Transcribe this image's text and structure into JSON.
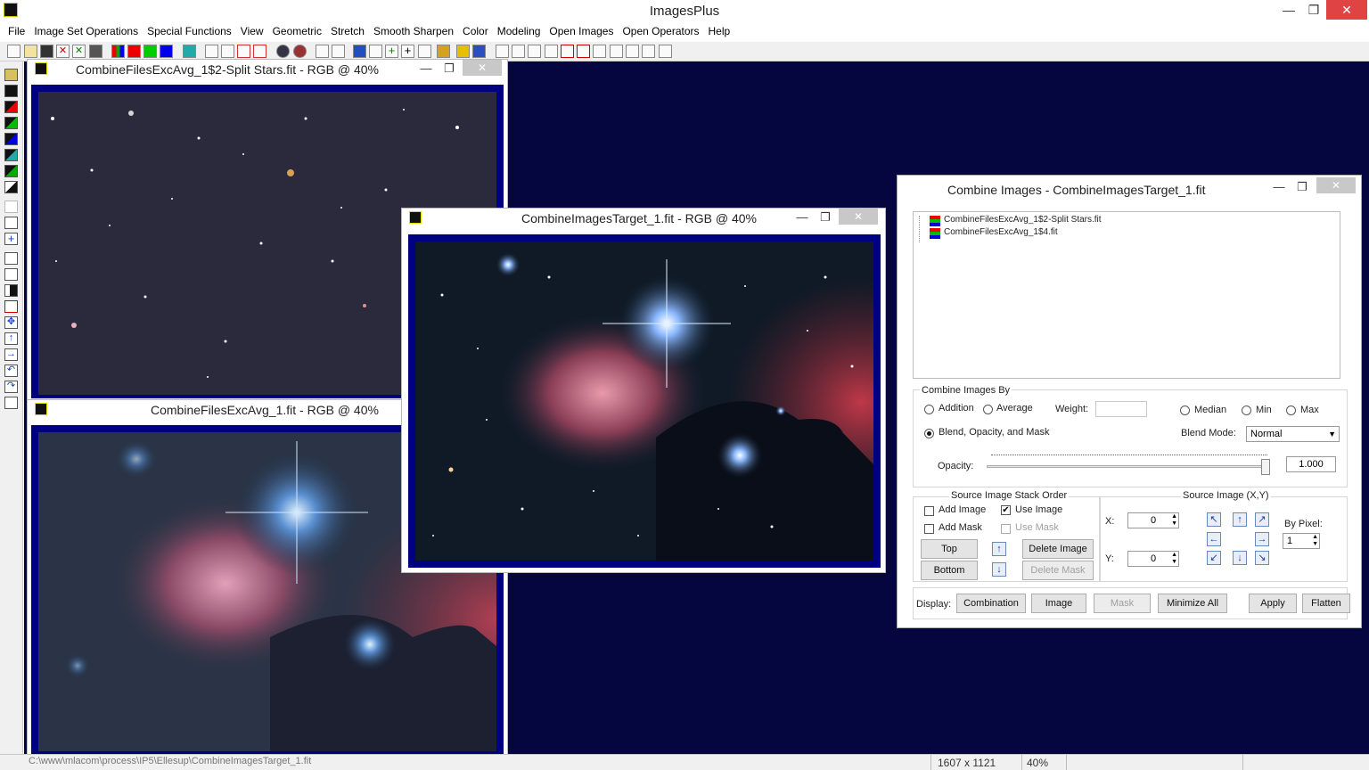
{
  "app": {
    "title": "ImagesPlus"
  },
  "window_controls": {
    "minimize": "—",
    "maximize": "❐",
    "close": "✕"
  },
  "menu": [
    "File",
    "Image Set Operations",
    "Special Functions",
    "View",
    "Geometric",
    "Stretch",
    "Smooth Sharpen",
    "Color",
    "Modeling",
    "Open Images",
    "Open Operators",
    "Help"
  ],
  "windows": {
    "stars": {
      "title": "CombineFilesExcAvg_1$2-Split Stars.fit - RGB @ 40%"
    },
    "avg": {
      "title": "CombineFilesExcAvg_1.fit - RGB @ 40%"
    },
    "target": {
      "title": "CombineImagesTarget_1.fit - RGB @ 40%"
    }
  },
  "dialog": {
    "title": "Combine Images - CombineImagesTarget_1.fit",
    "layers": [
      {
        "name": "CombineFilesExcAvg_1$2-Split Stars.fit"
      },
      {
        "name": "CombineFilesExcAvg_1$4.fit"
      }
    ],
    "combine_by": {
      "group_label": "Combine Images By",
      "addition": "Addition",
      "average": "Average",
      "weight_label": "Weight:",
      "weight_value": "",
      "median": "Median",
      "min": "Min",
      "max": "Max",
      "blend": "Blend, Opacity, and Mask",
      "blend_mode_label": "Blend Mode:",
      "blend_mode_value": "Normal",
      "opacity_label": "Opacity:",
      "opacity_value": "1.000",
      "selected": "Blend, Opacity, and Mask"
    },
    "stack_order": {
      "group_label": "Source Image Stack Order",
      "add_image": "Add Image",
      "use_image": "Use Image",
      "use_image_checked": "✔",
      "add_mask": "Add Mask",
      "use_mask": "Use Mask",
      "top": "Top",
      "bottom": "Bottom",
      "delete_image": "Delete Image",
      "delete_mask": "Delete Mask"
    },
    "source_image": {
      "group_label": "Source Image (X,Y)",
      "x_label": "X:",
      "x_value": "0",
      "y_label": "Y:",
      "y_value": "0",
      "by_pixel_label": "By Pixel:",
      "by_pixel_value": "1"
    },
    "display": {
      "label": "Display:",
      "combination": "Combination",
      "image": "Image",
      "mask": "Mask",
      "minimize_all": "Minimize All",
      "apply": "Apply",
      "flatten": "Flatten"
    }
  },
  "status": {
    "path": "C:\\www\\mlacom\\process\\IP5\\Ellesup\\CombineImagesTarget_1.fit",
    "dimensions": "1607 x 1121",
    "zoom": "40%"
  },
  "colors": {
    "desktop": "#05063f",
    "image_frame": "#000082",
    "close_red": "#e04343"
  }
}
